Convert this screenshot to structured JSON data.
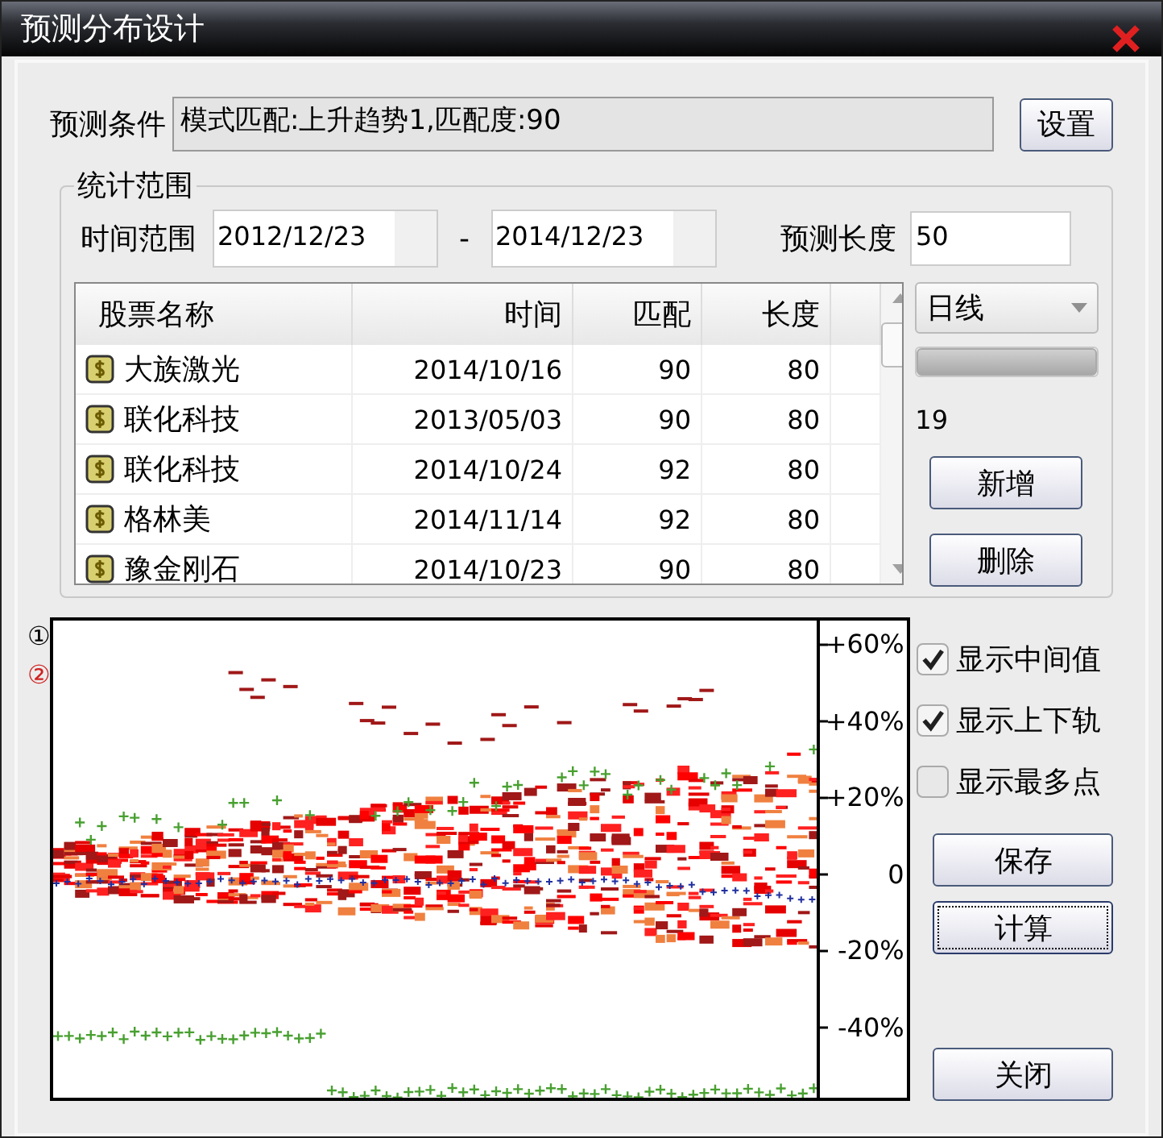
{
  "window": {
    "title": "预测分布设计"
  },
  "condition": {
    "label": "预测条件",
    "value": "模式匹配:上升趋势1,匹配度:90",
    "button": "设置"
  },
  "range_group": {
    "title": "统计范围",
    "time_label": "时间范围",
    "start": "2012/12/23",
    "separator": "-",
    "end": "2014/12/23",
    "length_label": "预测长度",
    "length": "50"
  },
  "table": {
    "columns": [
      "股票名称",
      "时间",
      "匹配",
      "长度"
    ],
    "rows": [
      {
        "name": "大族激光",
        "time": "2014/10/16",
        "match": "90",
        "length": "80"
      },
      {
        "name": "联化科技",
        "time": "2013/05/03",
        "match": "90",
        "length": "80"
      },
      {
        "name": "联化科技",
        "time": "2014/10/24",
        "match": "92",
        "length": "80"
      },
      {
        "name": "格林美",
        "time": "2014/11/14",
        "match": "92",
        "length": "80"
      },
      {
        "name": "豫金刚石",
        "time": "2014/10/23",
        "match": "90",
        "length": "80"
      }
    ]
  },
  "period": {
    "value": "日线"
  },
  "progress": {
    "level": 1
  },
  "count": "19",
  "list_buttons": [
    "新增",
    "删除"
  ],
  "chart": {
    "markers": [
      "①",
      "②"
    ],
    "y_labels": [
      "+60%",
      "+40%",
      "+20%",
      "0",
      "-20%",
      "-40%"
    ]
  },
  "options": [
    {
      "label": "显示中间值",
      "checked": true
    },
    {
      "label": "显示上下轨",
      "checked": true
    },
    {
      "label": "显示最多点",
      "checked": false
    }
  ],
  "actions": [
    {
      "label": "保存",
      "focused": false
    },
    {
      "label": "计算",
      "focused": true
    }
  ],
  "close_button": "关闭"
}
